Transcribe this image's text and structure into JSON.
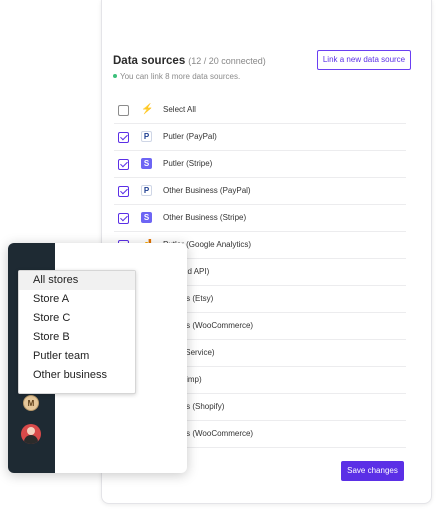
{
  "data_sources": {
    "title": "Data sources",
    "count": "(12 / 20 connected)",
    "note": "You can link 8 more data sources.",
    "link_button": "Link a new data source",
    "rows": [
      {
        "label": "Select All",
        "checked": false,
        "icon": "plug-icon"
      },
      {
        "label": "Putler (PayPal)",
        "checked": true,
        "icon": "paypal-icon"
      },
      {
        "label": "Putler (Stripe)",
        "checked": true,
        "icon": "stripe-icon"
      },
      {
        "label": "Other Business (PayPal)",
        "checked": true,
        "icon": "paypal-icon"
      },
      {
        "label": "Other Business (Stripe)",
        "checked": true,
        "icon": "stripe-icon"
      },
      {
        "label": "Putler (Google Analytics)",
        "checked": true,
        "icon": "google-analytics-icon"
      },
      {
        "label": "Inbound API)",
        "checked": false,
        "icon": ""
      },
      {
        "label": "usiness (Etsy)",
        "checked": false,
        "icon": ""
      },
      {
        "label": "usiness (WooCommerce)",
        "checked": false,
        "icon": ""
      },
      {
        "label": "Email Service)",
        "checked": false,
        "icon": ""
      },
      {
        "label": "Mailchimp)",
        "checked": false,
        "icon": ""
      },
      {
        "label": "usiness (Shopify)",
        "checked": false,
        "icon": ""
      },
      {
        "label": "usiness (WooCommerce)",
        "checked": false,
        "icon": ""
      }
    ],
    "save_button": "Save changes"
  },
  "store_menu": {
    "items": [
      "All stores",
      "Store A",
      "Store C",
      "Store B",
      "Putler team",
      "Other business"
    ],
    "selected": "All stores"
  },
  "sidebar": {
    "avatar_initial": "M"
  },
  "colors": {
    "accent": "#5b2fe6",
    "sidebar": "#1e2a33",
    "stripe": "#6d65f4"
  }
}
